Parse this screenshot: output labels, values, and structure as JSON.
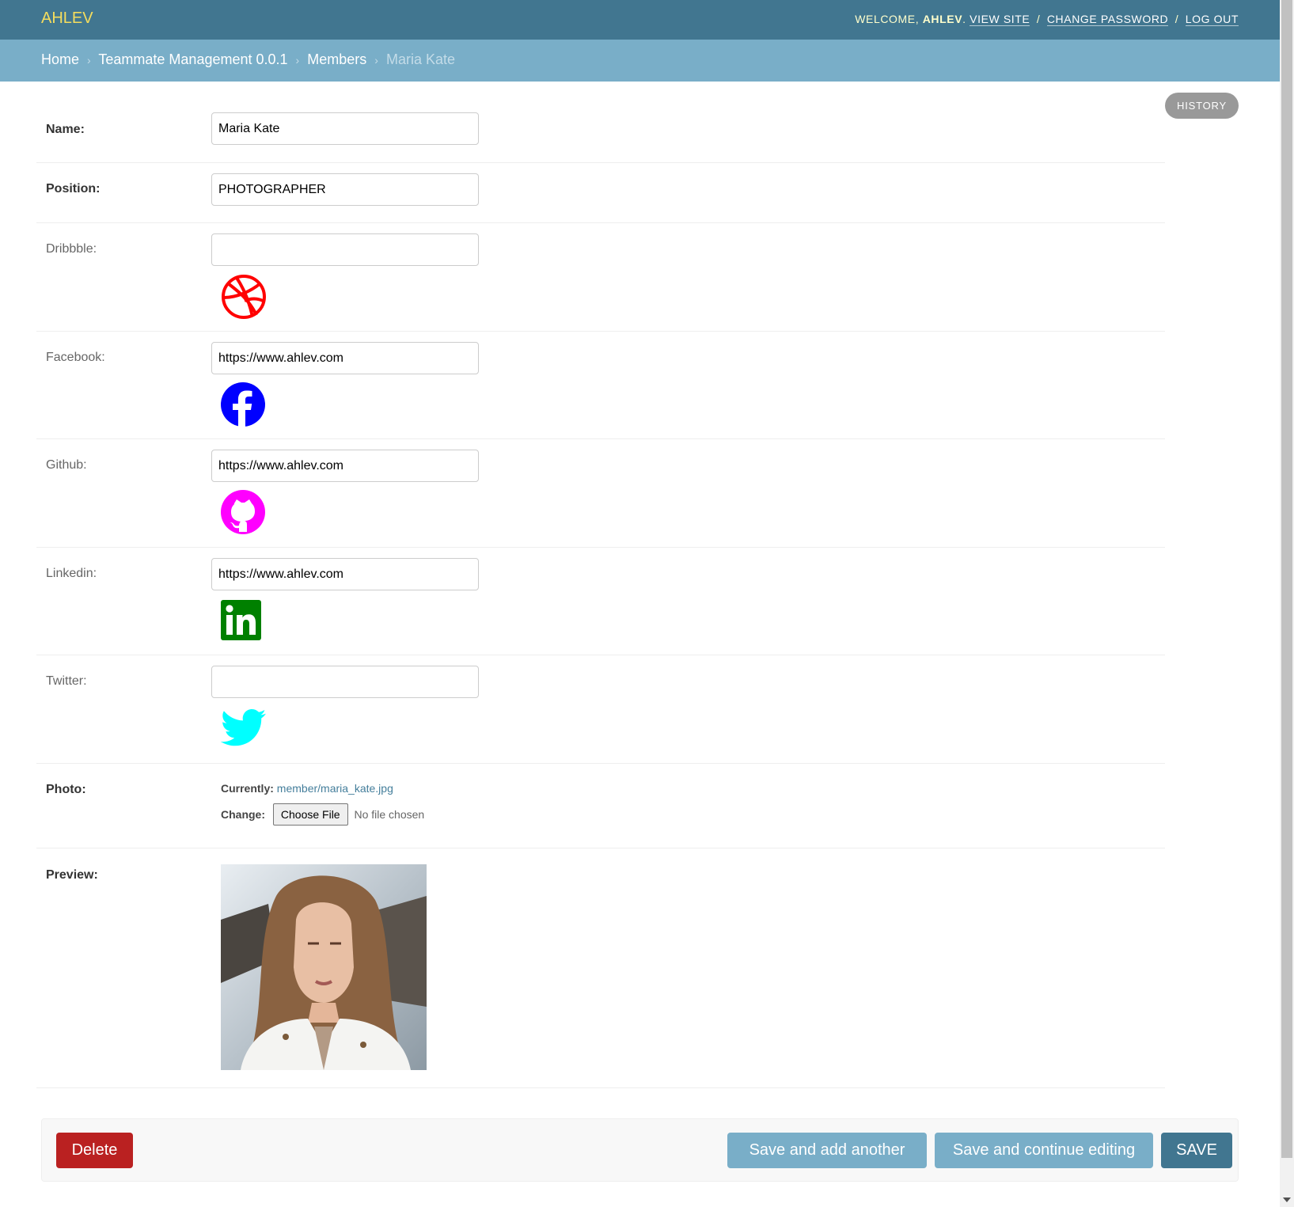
{
  "header": {
    "brand": "AHLEV",
    "welcome": "WELCOME, ",
    "username": "AHLEV",
    "view_site": "VIEW SITE",
    "change_password": "CHANGE PASSWORD",
    "log_out": "LOG OUT",
    "separator": "/"
  },
  "breadcrumbs": {
    "home": "Home",
    "app": "Teammate Management 0.0.1",
    "model": "Members",
    "current": "Maria Kate",
    "separator": "›"
  },
  "history_label": "HISTORY",
  "form": {
    "name": {
      "label": "Name:",
      "value": "Maria Kate"
    },
    "position": {
      "label": "Position:",
      "value": "PHOTOGRAPHER"
    },
    "dribbble": {
      "label": "Dribbble:",
      "value": "",
      "icon": "dribbble-icon",
      "color": "#ff0000"
    },
    "facebook": {
      "label": "Facebook:",
      "value": "https://www.ahlev.com",
      "icon": "facebook-icon",
      "color": "#0000ff"
    },
    "github": {
      "label": "Github:",
      "value": "https://www.ahlev.com",
      "icon": "github-icon",
      "color": "#ff00ff"
    },
    "linkedin": {
      "label": "Linkedin:",
      "value": "https://www.ahlev.com",
      "icon": "linkedin-icon",
      "color": "#008000"
    },
    "twitter": {
      "label": "Twitter:",
      "value": "",
      "icon": "twitter-icon",
      "color": "#00ffff"
    },
    "photo": {
      "label": "Photo:",
      "currently_label": "Currently:",
      "current_file": "member/maria_kate.jpg",
      "change_label": "Change:",
      "choose_file": "Choose File",
      "no_file": "No file chosen"
    },
    "preview": {
      "label": "Preview:"
    }
  },
  "actions": {
    "delete": "Delete",
    "save_add": "Save and add another",
    "save_continue": "Save and continue editing",
    "save": "SAVE"
  },
  "colors": {
    "header_bg": "#417690",
    "breadcrumb_bg": "#79aec8",
    "brand": "#f5dd5d",
    "delete": "#ba2121",
    "secondary_button": "#79aec8",
    "primary_button": "#417690"
  }
}
